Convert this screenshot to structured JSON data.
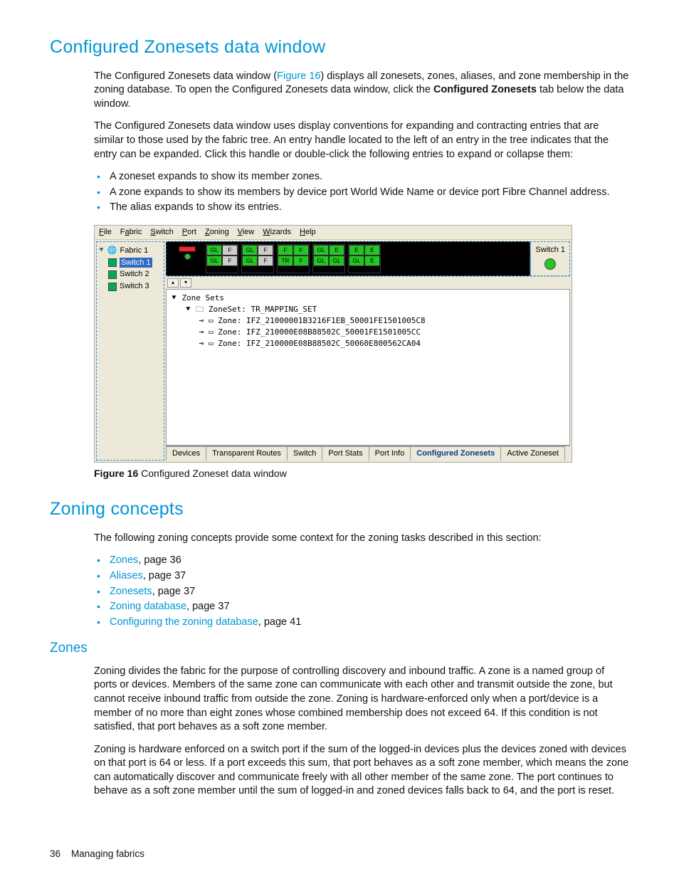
{
  "h1": "Configured Zonesets data window",
  "p1a": "The Configured Zonesets data window (",
  "p1link": "Figure 16",
  "p1b": ") displays all zonesets, zones, aliases, and zone membership in the zoning database. To open the Configured Zonesets data window, click the ",
  "p1bold": "Configured Zonesets",
  "p1c": " tab below the data window.",
  "p2": "The Configured Zonesets data window uses display conventions for expanding and contracting entries that are similar to those used by the fabric tree. An entry handle located to the left of an entry in the tree indicates that the entry can be expanded. Click this handle or double-click the following entries to expand or collapse them:",
  "b1": "A zoneset expands to show its member zones.",
  "b2": "A zone expands to show its members by device port World Wide Name or device port Fibre Channel address.",
  "b3": "The alias expands to show its entries.",
  "menus": {
    "file": "File",
    "fabric": "Fabric",
    "switch": "Switch",
    "port": "Port",
    "zoning": "Zoning",
    "view": "View",
    "wizards": "Wizards",
    "help": "Help"
  },
  "side": {
    "fabric": "Fabric 1",
    "s1": "Switch 1",
    "s2": "Switch 2",
    "s3": "Switch 3"
  },
  "rightlabel": "Switch 1",
  "ports": [
    [
      [
        "GL",
        "F"
      ],
      [
        "GL",
        "F"
      ]
    ],
    [
      [
        "GL",
        "F"
      ],
      [
        "GL",
        "F"
      ]
    ],
    [
      [
        "F",
        "F"
      ],
      [
        "TR",
        "F"
      ]
    ],
    [
      [
        "GL",
        "E"
      ],
      [
        "GL",
        "GL"
      ]
    ],
    [
      [
        "E",
        "E"
      ],
      [
        "GL",
        "E"
      ]
    ]
  ],
  "tree": {
    "root": "Zone Sets",
    "zs": "ZoneSet: TR_MAPPING_SET",
    "z1": "Zone: IFZ_21000001B3216F1EB_50001FE1501005C8",
    "z2": "Zone: IFZ_210000E08B88502C_50001FE1501005CC",
    "z3": "Zone: IFZ_210000E08B88502C_50060E800562CA04"
  },
  "tabs": [
    "Devices",
    "Transparent Routes",
    "Switch",
    "Port Stats",
    "Port Info",
    "Configured Zonesets",
    "Active Zoneset"
  ],
  "activeTab": 5,
  "figcap_b": "Figure 16",
  "figcap_t": " Configured Zoneset data window",
  "h1b": "Zoning concepts",
  "p3": "The following zoning concepts provide some context for the zoning tasks described in this section:",
  "toc": [
    {
      "t": "Zones",
      "p": ", page 36"
    },
    {
      "t": "Aliases",
      "p": ", page 37"
    },
    {
      "t": "Zonesets",
      "p": ", page 37"
    },
    {
      "t": "Zoning database",
      "p": ", page 37"
    },
    {
      "t": "Configuring the zoning database",
      "p": ", page 41"
    }
  ],
  "h2a": "Zones",
  "p4": "Zoning divides the fabric for the purpose of controlling discovery and inbound traffic. A zone is a named group of ports or devices. Members of the same zone can communicate with each other and transmit outside the zone, but cannot receive inbound traffic from outside the zone. Zoning is hardware-enforced only when a port/device is a member of no more than eight zones whose combined membership does not exceed 64. If this condition is not satisfied, that port behaves as a soft zone member.",
  "p5": "Zoning is hardware enforced on a switch port if the sum of the logged-in devices plus the devices zoned with devices on that port is 64 or less. If a port exceeds this sum, that port behaves as a soft zone member, which means the zone can automatically discover and communicate freely with all other member of the same zone. The port continues to behave as a soft zone member until the sum of logged-in and zoned devices falls back to 64, and the port is reset.",
  "footer_page": "36",
  "footer_text": "Managing fabrics"
}
